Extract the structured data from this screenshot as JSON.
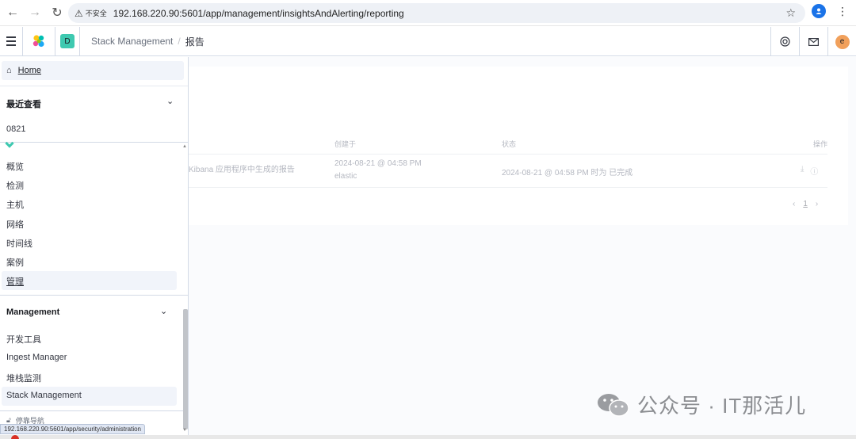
{
  "browser": {
    "security_label": "不安全",
    "url": "192.168.220.90:5601/app/management/insightsAndAlerting/reporting"
  },
  "header": {
    "space_initial": "D",
    "breadcrumb_parent": "Stack Management",
    "breadcrumb_sep": "/",
    "breadcrumb_current": "报告",
    "user_initial": "e"
  },
  "main": {
    "description": "Kibana 应用程序中生成的报告",
    "columns": [
      "创建于",
      "状态",
      "操作"
    ],
    "rows": [
      {
        "created": "2024-08-21 @ 04:58 PM",
        "created_by": "elastic",
        "status": "2024-08-21 @ 04:58 PM 时为 已完成"
      }
    ],
    "page": "1"
  },
  "sidenav": {
    "home": "Home",
    "recent_title": "最近查看",
    "recent_items": [
      "0821"
    ],
    "security_items": [
      "概览",
      "检测",
      "主机",
      "网络",
      "时间线",
      "案例",
      "管理"
    ],
    "management_title": "Management",
    "management_items": [
      "开发工具",
      "Ingest Manager",
      "堆栈监测",
      "Stack Management"
    ],
    "collapse_label": "停靠导航"
  },
  "status_bar": {
    "hover_url": "192.168.220.90:5601/app/security/administration"
  },
  "watermark": {
    "text": "公众号 · IT那活儿"
  },
  "colors": {
    "space_badge": "#3ec9b0",
    "avatar": "#f1a05b",
    "nav_active": "#f1f4fa"
  }
}
